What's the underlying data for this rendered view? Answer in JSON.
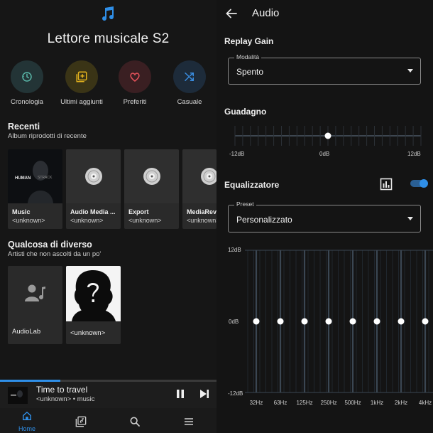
{
  "left": {
    "app_title": "Lettore musicale S2",
    "quick_actions": [
      {
        "label": "Cronologia",
        "icon": "history-icon",
        "bg": "#233436",
        "fg": "#59b5a7"
      },
      {
        "label": "Ultimi aggiunti",
        "icon": "playlist-add-icon",
        "bg": "#3a3416",
        "fg": "#e3b21e"
      },
      {
        "label": "Preferiti",
        "icon": "heart-icon",
        "bg": "#3a1f22",
        "fg": "#e5525a"
      },
      {
        "label": "Casuale",
        "icon": "shuffle-icon",
        "bg": "#1d2b3a",
        "fg": "#3a8de0"
      }
    ],
    "recent": {
      "title": "Recenti",
      "subtitle": "Album riprodotti di recente",
      "albums": [
        {
          "title": "Music",
          "artist": "<unknown>"
        },
        {
          "title": "Audio Media ...",
          "artist": "<unknown>"
        },
        {
          "title": "Export",
          "artist": "<unknown>"
        },
        {
          "title": "MediaReve",
          "artist": "<unknown>"
        }
      ],
      "cover_text": [
        "HUMAN",
        "STRACK"
      ]
    },
    "discover": {
      "title": "Qualcosa di diverso",
      "subtitle": "Artisti che non ascolti da un po'",
      "artists": [
        {
          "name": "AudioLab"
        },
        {
          "name": "<unknown>"
        }
      ]
    },
    "mini_player": {
      "title": "Time to travel",
      "subtitle": "<unknown> • music",
      "progress": 0.28
    },
    "nav": {
      "home_label": "Home"
    }
  },
  "right": {
    "title": "Audio",
    "replay_gain": {
      "section": "Replay Gain",
      "field_label": "Modalità",
      "value": "Spento"
    },
    "gain": {
      "section": "Guadagno",
      "min_label": "-12dB",
      "mid_label": "0dB",
      "max_label": "12dB",
      "value_db": 0,
      "min_db": -12,
      "max_db": 12
    },
    "equalizer": {
      "section": "Equalizzatore",
      "enabled": true,
      "preset_label": "Preset",
      "preset_value": "Personalizzato",
      "y_top": "12dB",
      "y_mid": "0dB",
      "y_bottom": "-12dB",
      "bands": [
        "32Hz",
        "63Hz",
        "125Hz",
        "250Hz",
        "500Hz",
        "1kHz",
        "2kHz",
        "4kHz"
      ],
      "band_values_db": [
        0,
        0,
        0,
        0,
        0,
        0,
        0,
        0
      ]
    }
  },
  "colors": {
    "accent": "#2f8fe8"
  }
}
